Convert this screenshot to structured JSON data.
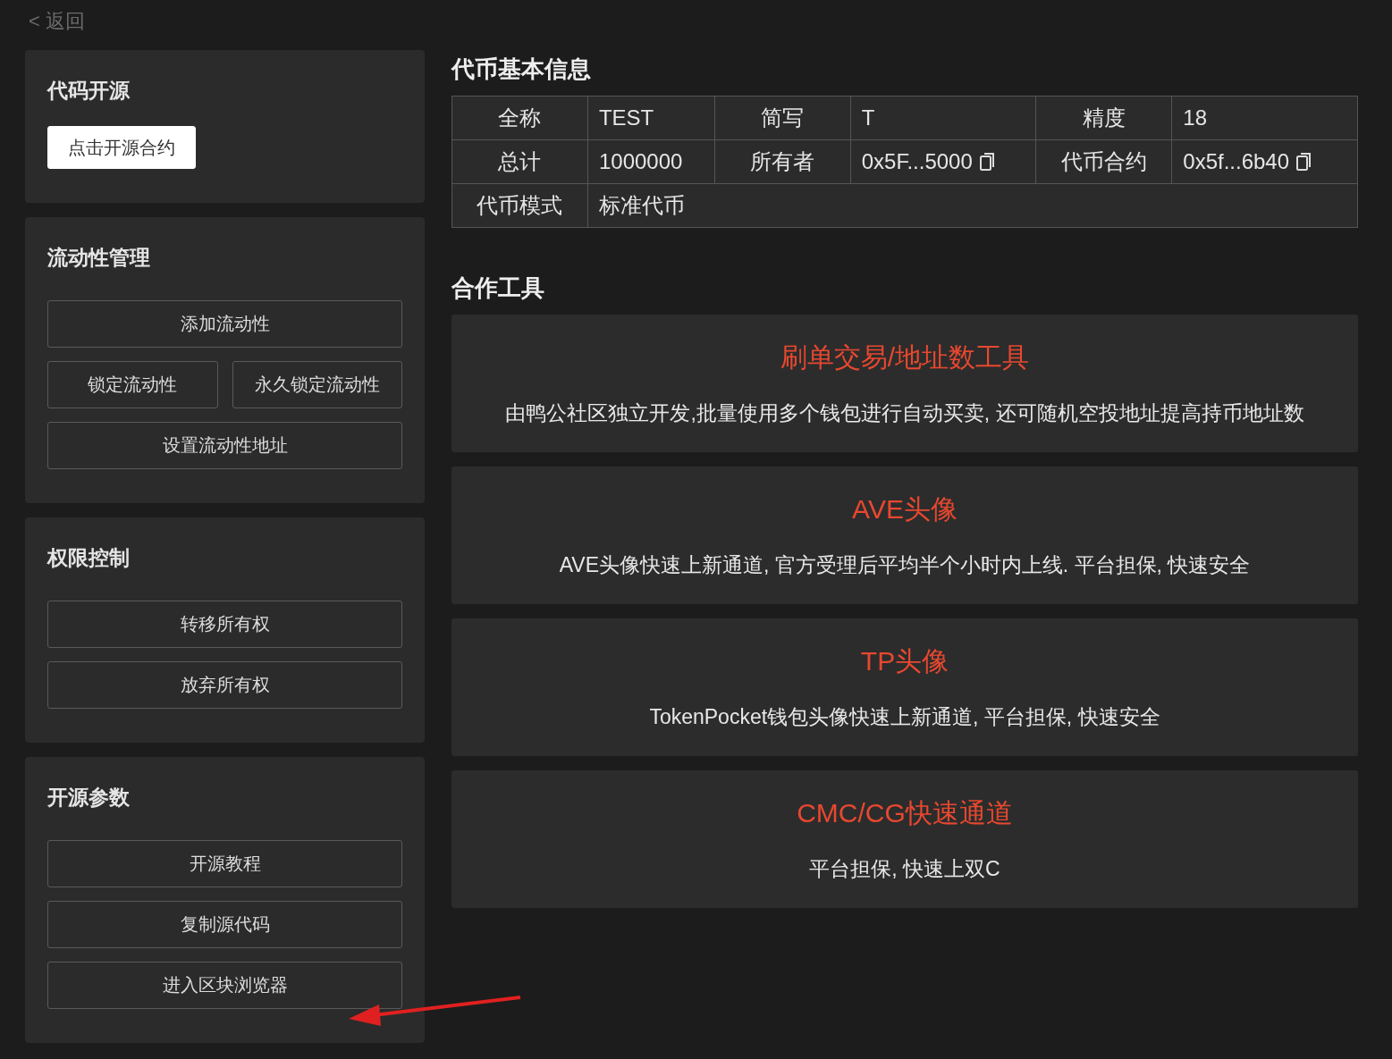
{
  "back_link": "< 返回",
  "sidebar_cards": [
    {
      "title": "代码开源",
      "rows": [
        [
          {
            "label": "点击开源合约",
            "kind": "primary"
          }
        ]
      ]
    },
    {
      "title": "流动性管理",
      "rows": [
        [
          {
            "label": "添加流动性",
            "kind": "outline"
          }
        ],
        [
          {
            "label": "锁定流动性",
            "kind": "outline"
          },
          {
            "label": "永久锁定流动性",
            "kind": "outline"
          }
        ],
        [
          {
            "label": "设置流动性地址",
            "kind": "outline"
          }
        ]
      ]
    },
    {
      "title": "权限控制",
      "rows": [
        [
          {
            "label": "转移所有权",
            "kind": "outline"
          }
        ],
        [
          {
            "label": "放弃所有权",
            "kind": "outline"
          }
        ]
      ]
    },
    {
      "title": "开源参数",
      "rows": [
        [
          {
            "label": "开源教程",
            "kind": "outline"
          }
        ],
        [
          {
            "label": "复制源代码",
            "kind": "outline"
          }
        ],
        [
          {
            "label": "进入区块浏览器",
            "kind": "outline"
          }
        ]
      ]
    }
  ],
  "token_info": {
    "title": "代币基本信息",
    "rows": [
      [
        {
          "text": "全称",
          "kind": "label",
          "copyable": false
        },
        {
          "text": "TEST",
          "kind": "value",
          "copyable": false
        },
        {
          "text": "简写",
          "kind": "label",
          "copyable": false
        },
        {
          "text": "T",
          "kind": "value",
          "copyable": false
        },
        {
          "text": "精度",
          "kind": "label",
          "copyable": false
        },
        {
          "text": "18",
          "kind": "value",
          "copyable": false
        }
      ],
      [
        {
          "text": "总计",
          "kind": "label",
          "copyable": false
        },
        {
          "text": "1000000",
          "kind": "value",
          "copyable": false
        },
        {
          "text": "所有者",
          "kind": "label",
          "copyable": false
        },
        {
          "text": "0x5F...5000",
          "kind": "value",
          "copyable": true
        },
        {
          "text": "代币合约",
          "kind": "label",
          "copyable": false
        },
        {
          "text": "0x5f...6b40",
          "kind": "value",
          "copyable": true
        }
      ],
      [
        {
          "text": "代币模式",
          "kind": "label",
          "copyable": false
        },
        {
          "text": "标准代币",
          "kind": "value",
          "copyable": false,
          "colspan": 5
        }
      ]
    ]
  },
  "tools": {
    "title": "合作工具",
    "items": [
      {
        "name": "刷单交易/地址数工具",
        "description": "由鸭公社区独立开发,批量使用多个钱包进行自动买卖, 还可随机空投地址提高持币地址数"
      },
      {
        "name": "AVE头像",
        "description": "AVE头像快速上新通道, 官方受理后平均半个小时内上线. 平台担保, 快速安全"
      },
      {
        "name": "TP头像",
        "description": "TokenPocket钱包头像快速上新通道, 平台担保, 快速安全"
      },
      {
        "name": "CMC/CG快速通道",
        "description": "平台担保, 快速上双C"
      }
    ]
  }
}
